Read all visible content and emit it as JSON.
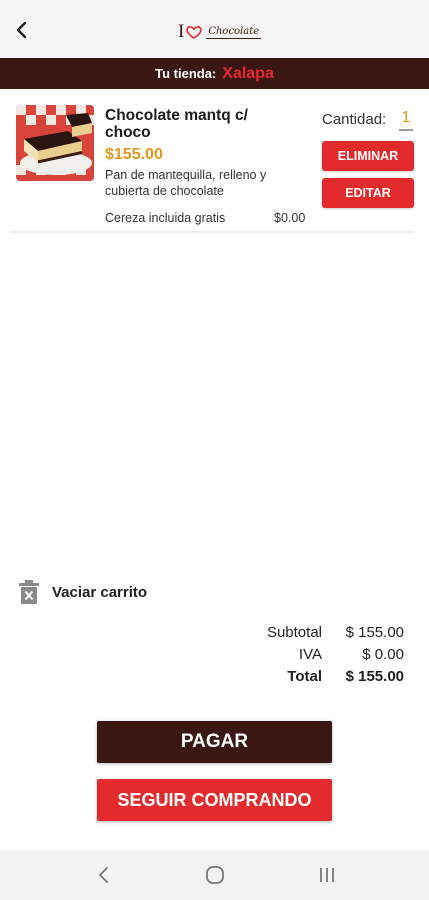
{
  "header": {
    "logo_text": "I ♥ Chocolate"
  },
  "store": {
    "label": "Tu tienda:",
    "name": "Xalapa"
  },
  "cart": {
    "items": [
      {
        "name": "Chocolate mantq c/ choco",
        "price": "$155.00",
        "description": "Pan de mantequilla, relleno y cubierta de chocolate",
        "extra_label": "Cereza incluida gratis",
        "extra_price": "$0.00",
        "quantity_label": "Cantidad:",
        "quantity": "1",
        "remove_label": "ELIMINAR",
        "edit_label": "EDITAR"
      }
    ],
    "clear_label": "Vaciar carrito"
  },
  "totals": {
    "subtotal_label": "Subtotal",
    "subtotal_value": "$ 155.00",
    "iva_label": "IVA",
    "iva_value": "$ 0.00",
    "total_label": "Total",
    "total_value": "$ 155.00"
  },
  "actions": {
    "pay_label": "PAGAR",
    "continue_label": "SEGUIR COMPRANDO"
  },
  "icons": {
    "back": "back-arrow-icon",
    "trash": "trash-icon",
    "nav_back": "nav-back-icon",
    "nav_home": "nav-home-icon",
    "nav_recents": "nav-recents-icon"
  },
  "colors": {
    "brand_dark": "#3b1714",
    "accent_red": "#e32b2d",
    "price_orange": "#e3951d"
  }
}
